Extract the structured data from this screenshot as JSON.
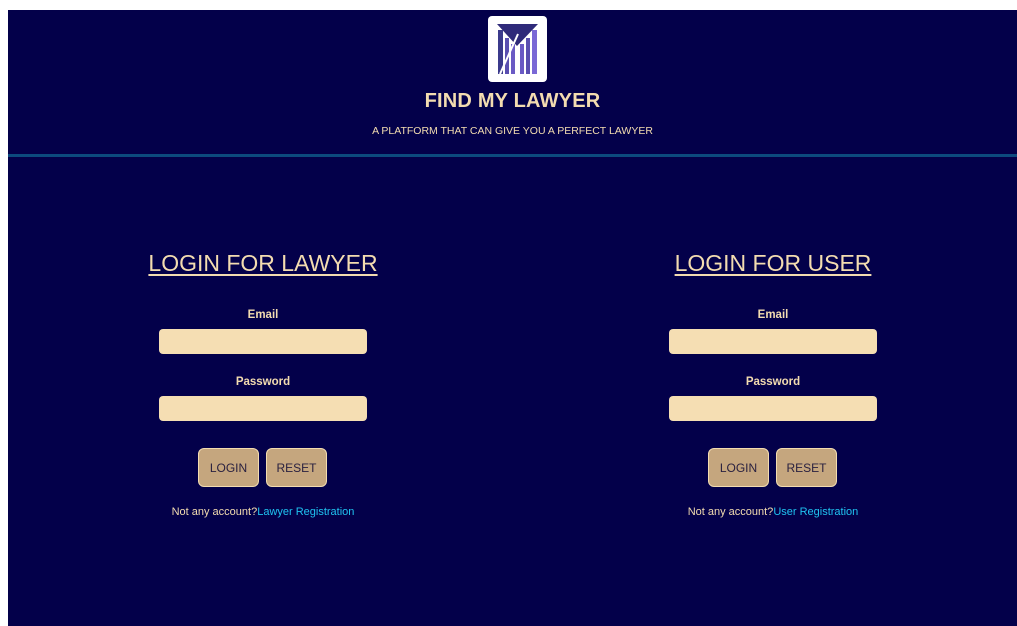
{
  "header": {
    "title": "FIND MY LAWYER",
    "tagline": "A PLATFORM THAT CAN GIVE YOU A PERFECT LAWYER",
    "logo_icon": "scales-m-logo-icon"
  },
  "colors": {
    "background": "#03004a",
    "accent_text": "#f3dcb0",
    "input_bg": "#f5deb3",
    "button_bg": "#c5a67e",
    "link": "#1fc2f0",
    "divider": "#0c4a7e"
  },
  "lawyer_login": {
    "title": "LOGIN FOR LAWYER",
    "email_label": "Email",
    "email_value": "",
    "password_label": "Password",
    "password_value": "",
    "login_label": "LOGIN",
    "reset_label": "RESET",
    "account_prompt": "Not any account?",
    "register_link": "Lawyer Registration"
  },
  "user_login": {
    "title": "LOGIN FOR USER",
    "email_label": "Email",
    "email_value": "",
    "password_label": "Password",
    "password_value": "",
    "login_label": "LOGIN",
    "reset_label": "RESET",
    "account_prompt": "Not any account?",
    "register_link": "User Registration"
  }
}
